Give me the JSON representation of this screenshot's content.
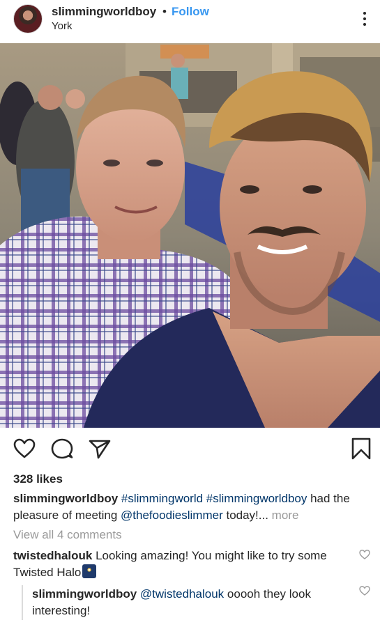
{
  "post": {
    "username": "slimmingworldboy",
    "separator": "•",
    "follow_label": "Follow",
    "location": "York",
    "likes_text": "328 likes",
    "caption": {
      "username": "slimmingworldboy",
      "parts": [
        {
          "text": " ",
          "tag": false
        },
        {
          "text": "#slimmingworld",
          "tag": true
        },
        {
          "text": " ",
          "tag": false
        },
        {
          "text": "#slimmingworldboy",
          "tag": true
        },
        {
          "text": " had the pleasure of meeting ",
          "tag": false
        },
        {
          "text": "@thefoodieslimmer",
          "tag": true
        },
        {
          "text": " today!...",
          "tag": false
        }
      ],
      "more_label": " more"
    },
    "view_all_comments": "View all 4 comments"
  },
  "comments": [
    {
      "username": "twistedhalouk",
      "text": " Looking amazing! You might like to try some Twisted Halo",
      "emoji_icon": "night-sky-emoji"
    },
    {
      "username": "slimmingworldboy",
      "mention": " @twistedhalouk",
      "text": " ooooh they look interesting!"
    }
  ],
  "icons": {
    "like": "heart-icon",
    "comment": "comment-bubble-icon",
    "share": "paper-plane-icon",
    "save": "bookmark-icon",
    "more": "vertical-dots-icon"
  },
  "colors": {
    "link": "#003569",
    "follow": "#3897f0",
    "muted": "#999999",
    "text": "#262626"
  }
}
